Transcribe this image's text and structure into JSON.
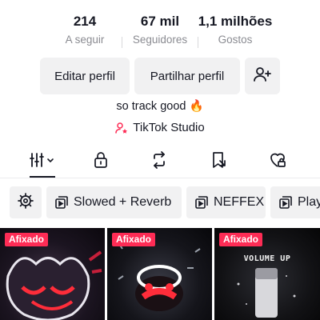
{
  "stats": [
    {
      "value": "214",
      "label": "A seguir"
    },
    {
      "value": "67 mil",
      "label": "Seguidores"
    },
    {
      "value": "1,1 milhões",
      "label": "Gostos"
    }
  ],
  "actions": {
    "edit_label": "Editar perfil",
    "share_label": "Partilhar perfil",
    "add_friend_icon": "person-add-icon"
  },
  "bio": "so track good 🔥",
  "studio_link": "TikTok Studio",
  "tabs": [
    {
      "icon": "grid-filter-icon",
      "active": true
    },
    {
      "icon": "lock-icon",
      "active": false
    },
    {
      "icon": "repost-icon",
      "active": false
    },
    {
      "icon": "bookmark-icon",
      "active": false
    },
    {
      "icon": "liked-heart-icon",
      "active": false
    }
  ],
  "playlists": [
    {
      "icon": "settings-icon",
      "label": ""
    },
    {
      "icon": "playlist-icon",
      "label": "Slowed + Reverb"
    },
    {
      "icon": "playlist-icon",
      "label": "NEFFEX"
    },
    {
      "icon": "playlist-icon",
      "label": "Play"
    }
  ],
  "videos": [
    {
      "badge": "Afixado"
    },
    {
      "badge": "Afixado"
    },
    {
      "badge": "Afixado",
      "overlay_text": "VOLUME UP"
    }
  ],
  "colors": {
    "badge_bg": "#fe2c55",
    "button_bg": "#f1f1f2",
    "text_primary": "#161823",
    "text_secondary": "#8a8b91"
  }
}
